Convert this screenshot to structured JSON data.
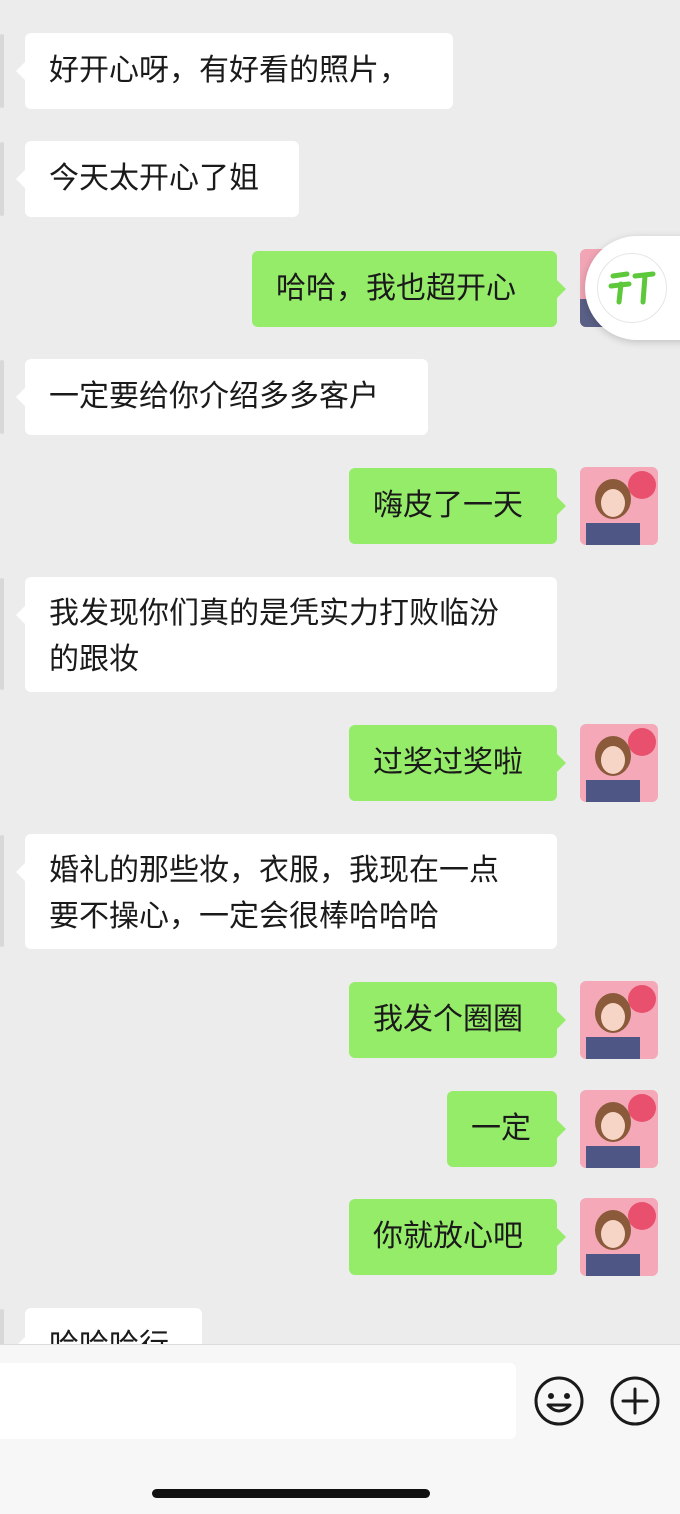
{
  "messages": [
    {
      "side": "in",
      "text": "好开心呀，有好看的照片，"
    },
    {
      "side": "in",
      "text": "今天太开心了姐"
    },
    {
      "side": "out",
      "text": "哈哈，我也超开心"
    },
    {
      "side": "in",
      "text": "一定要给你介绍多多客户"
    },
    {
      "side": "out",
      "text": "嗨皮了一天"
    },
    {
      "side": "in",
      "text": "我发现你们真的是凭实力打败临汾\n的跟妆"
    },
    {
      "side": "out",
      "text": "过奖过奖啦"
    },
    {
      "side": "in",
      "text": "婚礼的那些妆，衣服，我现在一点\n要不操心，一定会很棒哈哈哈"
    },
    {
      "side": "out",
      "text": "我发个圈圈"
    },
    {
      "side": "out",
      "text": "一定"
    },
    {
      "side": "out",
      "text": "你就放心吧"
    },
    {
      "side": "in",
      "text": "哈哈哈行"
    }
  ],
  "input": {
    "value": "",
    "placeholder": ""
  },
  "icons": {
    "emoji": "emoji-icon",
    "add": "add-icon",
    "floating": "mini-program-icon"
  },
  "colors": {
    "background": "#ececec",
    "incoming_bubble": "#ffffff",
    "outgoing_bubble": "#95ec69",
    "floating_logo": "#5cc83a"
  }
}
